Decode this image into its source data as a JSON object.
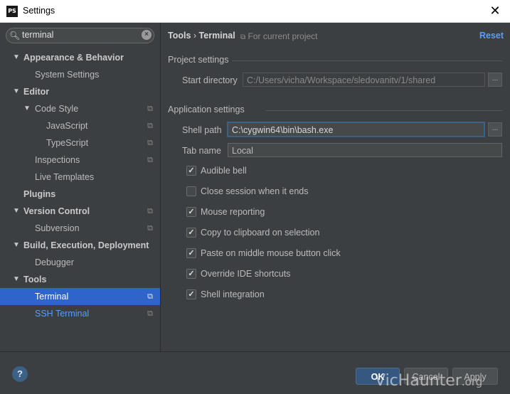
{
  "window": {
    "app_icon": "PS",
    "title": "Settings",
    "close_icon": "close-icon"
  },
  "sidebar": {
    "search": {
      "value": "terminal",
      "icon": "search-icon",
      "clear_icon": "clear-icon"
    },
    "items": [
      {
        "label": "Appearance & Behavior",
        "arrow": "▼",
        "bold": true
      },
      {
        "label": "System Settings"
      },
      {
        "label": "Editor",
        "arrow": "▼",
        "bold": true
      },
      {
        "label": "Code Style",
        "arrow": "▼",
        "project": true
      },
      {
        "label": "JavaScript",
        "project": true
      },
      {
        "label": "TypeScript",
        "project": true
      },
      {
        "label": "Inspections",
        "project": true
      },
      {
        "label": "Live Templates"
      },
      {
        "label": "Plugins",
        "bold": true
      },
      {
        "label": "Version Control",
        "arrow": "▼",
        "bold": true,
        "project": true
      },
      {
        "label": "Subversion",
        "project": true
      },
      {
        "label": "Build, Execution, Deployment",
        "arrow": "▼",
        "bold": true
      },
      {
        "label": "Debugger"
      },
      {
        "label": "Tools",
        "arrow": "▼",
        "bold": true
      },
      {
        "label": "Terminal",
        "project": true,
        "selected": true
      },
      {
        "label": "SSH Terminal",
        "project": true,
        "link": true
      }
    ]
  },
  "header": {
    "crumb_1": "Tools",
    "separator": "›",
    "crumb_2": "Terminal",
    "project_note": "For current project",
    "reset_label": "Reset"
  },
  "project_settings": {
    "title": "Project settings",
    "start_directory_label": "Start directory",
    "start_directory_value": "C:/Users/vicha/Workspace/sledovanitv/1/shared",
    "browse_label": "..."
  },
  "app_settings": {
    "title": "Application settings",
    "shell_path_label": "Shell path",
    "shell_path_value": "C:\\cygwin64\\bin\\bash.exe",
    "tab_name_label": "Tab name",
    "tab_name_value": "Local",
    "browse_label": "..."
  },
  "options": [
    {
      "label": "Audible bell",
      "checked": true
    },
    {
      "label": "Close session when it ends",
      "checked": false
    },
    {
      "label": "Mouse reporting",
      "checked": true
    },
    {
      "label": "Copy to clipboard on selection",
      "checked": true
    },
    {
      "label": "Paste on middle mouse button click",
      "checked": true
    },
    {
      "label": "Override IDE shortcuts",
      "checked": true
    },
    {
      "label": "Shell integration",
      "checked": true
    }
  ],
  "footer": {
    "help_label": "?",
    "ok_label": "OK",
    "cancel_label": "Cancel",
    "apply_label": "Apply"
  },
  "watermark": {
    "text": "VicHaunter",
    "suffix": ".org"
  },
  "colors": {
    "background": "#3c3f41",
    "selection": "#2f65ca",
    "link": "#589df6",
    "focus_border": "#3d6185"
  }
}
